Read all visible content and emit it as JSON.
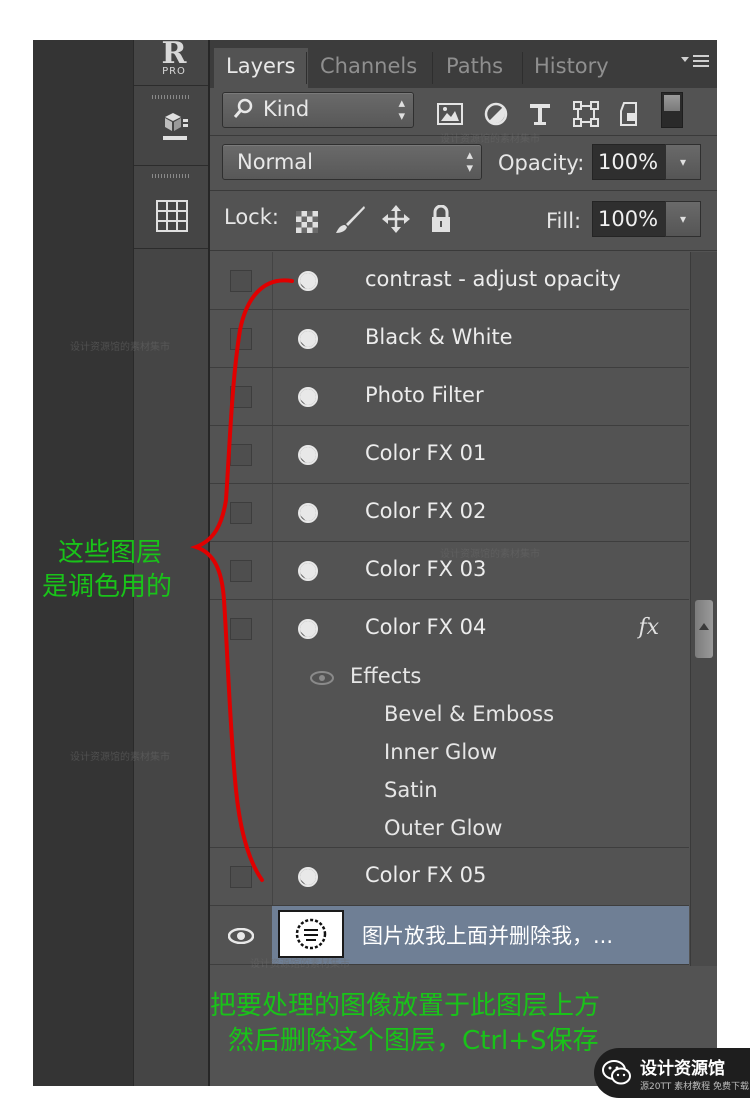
{
  "app": {
    "logo_letter": "R",
    "logo_sub": "PRO"
  },
  "tabs": [
    {
      "label": "Layers",
      "active": true
    },
    {
      "label": "Channels",
      "active": false
    },
    {
      "label": "Paths",
      "active": false
    },
    {
      "label": "History",
      "active": false
    }
  ],
  "filter": {
    "kind_label": "Kind",
    "icons": [
      "image-filter-icon",
      "adjustment-filter-icon",
      "type-filter-icon",
      "shape-filter-icon",
      "smart-object-filter-icon"
    ]
  },
  "blend": {
    "mode": "Normal",
    "opacity_label": "Opacity:",
    "opacity_value": "100%"
  },
  "lock": {
    "label": "Lock:",
    "fill_label": "Fill:",
    "fill_value": "100%"
  },
  "layers": [
    {
      "name": "contrast - adjust opacity",
      "visible": false
    },
    {
      "name": "Black & White",
      "visible": false
    },
    {
      "name": "Photo Filter",
      "visible": false
    },
    {
      "name": "Color FX 01",
      "visible": false
    },
    {
      "name": "Color FX 02",
      "visible": false
    },
    {
      "name": "Color FX 03",
      "visible": false
    },
    {
      "name": "Color FX 04",
      "visible": false,
      "fx": "fx"
    },
    {
      "name": "Color FX 05",
      "visible": false
    },
    {
      "name": "图片放我上面并删除我，...",
      "visible": true,
      "selected": true
    }
  ],
  "effects": {
    "label": "Effects",
    "items": [
      "Bevel & Emboss",
      "Inner Glow",
      "Satin",
      "Outer Glow"
    ]
  },
  "annotations": {
    "left_line1": "这些图层",
    "left_line2": "是调色用的",
    "bottom_line1": "把要处理的图像放置于此图层上方",
    "bottom_line2": "然后删除这个图层，Ctrl+S保存",
    "color": "#19c319"
  },
  "watermark": {
    "text": "设计资源馆的素材集市"
  },
  "badge": {
    "title": "设计资源馆",
    "subtitle": "源20TT 素材教程 免费下载"
  },
  "colors": {
    "panel": "#535353",
    "selected": "#6f7f95",
    "annotation": "#19c319",
    "bracket": "#e00000"
  }
}
